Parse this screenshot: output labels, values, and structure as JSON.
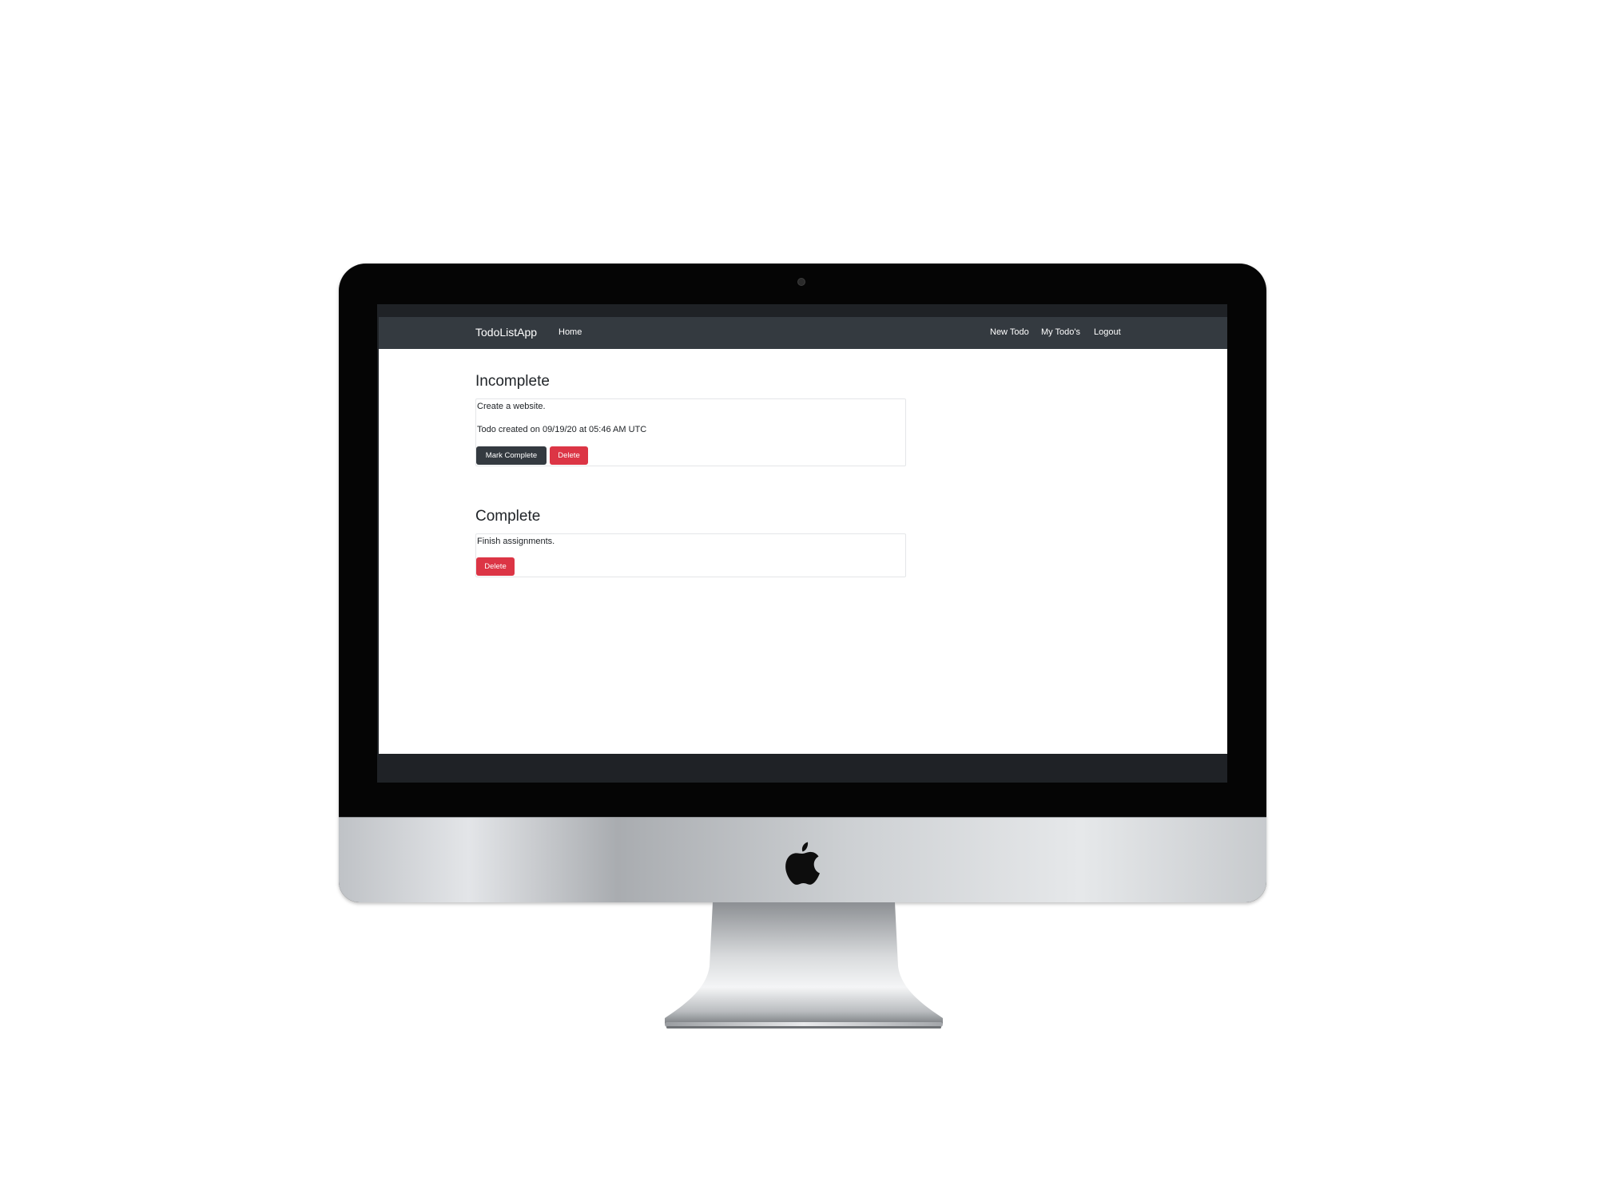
{
  "navbar": {
    "brand": "TodoListApp",
    "left_links": [
      "Home"
    ],
    "right_links": [
      "New Todo",
      "My Todo's",
      "Logout"
    ]
  },
  "incomplete": {
    "title": "Incomplete",
    "todos": [
      {
        "text": "Create a website.",
        "created": "Todo created on 09/19/20 at 05:46 AM UTC",
        "mark_complete_label": "Mark Complete",
        "delete_label": "Delete"
      }
    ]
  },
  "complete": {
    "title": "Complete",
    "todos": [
      {
        "text": "Finish assignments.",
        "delete_label": "Delete"
      }
    ]
  },
  "colors": {
    "navbar_bg": "#343a40",
    "danger": "#dc3545",
    "dark_button": "#343a40"
  },
  "icons": {
    "hardware_logo": "apple-logo-icon",
    "camera": "camera-icon"
  }
}
